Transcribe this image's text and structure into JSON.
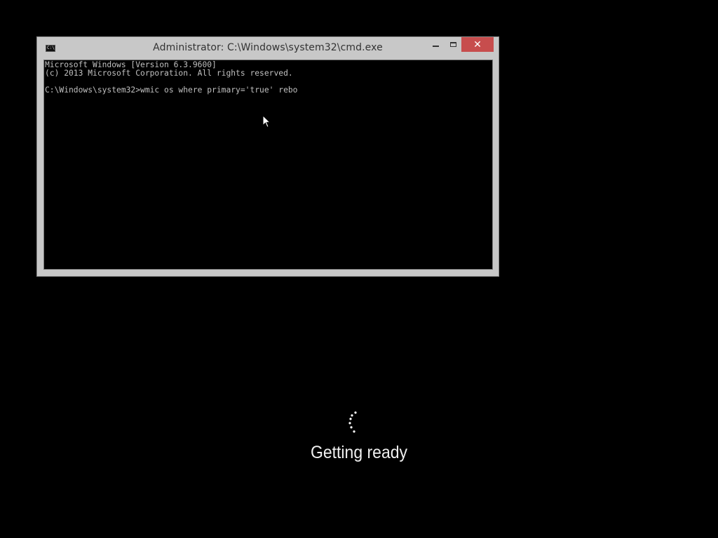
{
  "window": {
    "title": "Administrator: C:\\Windows\\system32\\cmd.exe",
    "icon": "cmd-icon",
    "icon_text": "C:\\",
    "controls": {
      "minimize": "minimize-icon",
      "maximize": "maximize-icon",
      "close": "✕"
    },
    "close_color": "#c74d4d"
  },
  "console": {
    "lines": [
      "Microsoft Windows [Version 6.3.9600]",
      "(c) 2013 Microsoft Corporation. All rights reserved.",
      "",
      "C:\\Windows\\system32>wmic os where primary='true' rebo"
    ],
    "text_color": "#c0c0c0",
    "background": "#000000"
  },
  "status": {
    "message": "Getting ready",
    "spinner": "loading-spinner-icon"
  }
}
